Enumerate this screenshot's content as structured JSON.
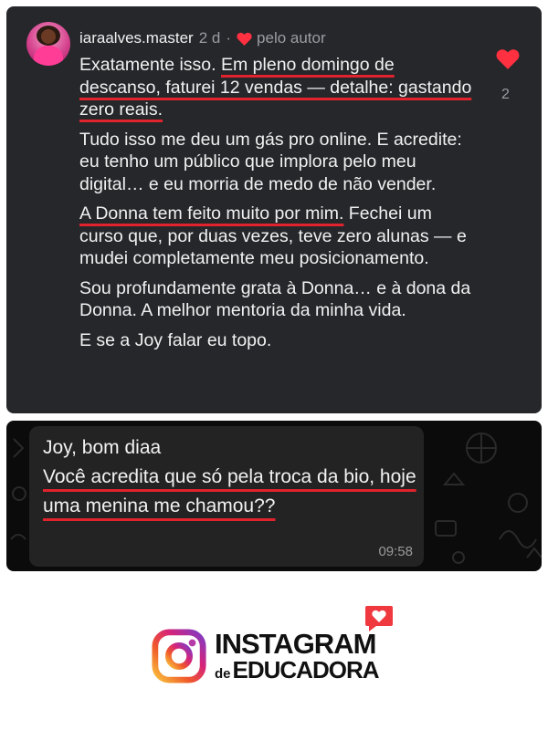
{
  "comment": {
    "username": "iaraalves.master",
    "time": "2 d",
    "separator": "·",
    "author_like_label": "pelo autor",
    "like_count": "2",
    "icons": {
      "like": "heart-icon",
      "author_like": "heart-icon",
      "avatar": "profile-photo"
    },
    "paragraphs": [
      {
        "a": "Exatamente isso. ",
        "b": "Em pleno domingo de descanso, faturei 12 vendas — detalhe: gastando zero reais."
      },
      {
        "a": "Tudo isso me deu um gás pro online. E acredite: eu tenho um público que implora pelo meu digital… e eu morria de medo de não vender."
      },
      {
        "u": "A Donna tem feito muito por mim.",
        "c": " Fechei um curso que, por duas vezes, teve zero alunas — e mudei completamente meu posicionamento."
      },
      {
        "a": "Sou profundamente grata à Donna… e à dona da Donna. A melhor mentoria da minha vida."
      },
      {
        "a": "E se a Joy falar eu topo."
      }
    ]
  },
  "whatsapp": {
    "greeting": "Joy, bom diaa",
    "message": "Você acredita que só pela troca da bio, hoje uma menina me chamou??",
    "time": "09:58"
  },
  "brand": {
    "title": "INSTAGRAM",
    "sub_prefix": "de",
    "sub_word": "EDUCADORA",
    "icons": {
      "logo": "instagram-icon",
      "badge": "heart-notification-icon"
    }
  },
  "colors": {
    "comment_bg": "#25272b",
    "heart": "#ff3040",
    "underline": "#e0232c",
    "wa_bubble": "#232323"
  }
}
